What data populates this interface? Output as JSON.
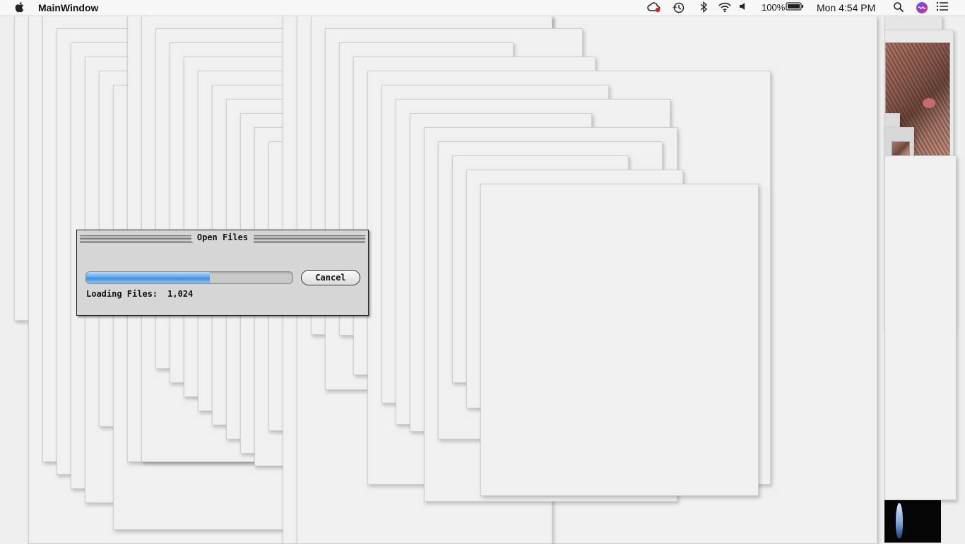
{
  "menubar": {
    "apple_icon": "apple-icon",
    "app_name": "MainWindow",
    "battery_percent": "100%",
    "clock": "Mon 4:54 PM",
    "status_icons": [
      "creative-cloud-icon",
      "time-machine-icon",
      "bluetooth-icon",
      "wifi-icon",
      "volume-icon",
      "battery-icon",
      "spotlight-search-icon",
      "siri-icon",
      "notification-center-icon"
    ]
  },
  "dialog": {
    "title": "Open Files",
    "cancel_label": "Cancel",
    "status_label": "Loading Files:",
    "status_value": "1,024",
    "progress_fraction": 0.6
  },
  "colors": {
    "progress_fill": "#5fa8ec",
    "window_bg": "#f0f0f0",
    "dialog_bg": "#d6d6d6"
  }
}
